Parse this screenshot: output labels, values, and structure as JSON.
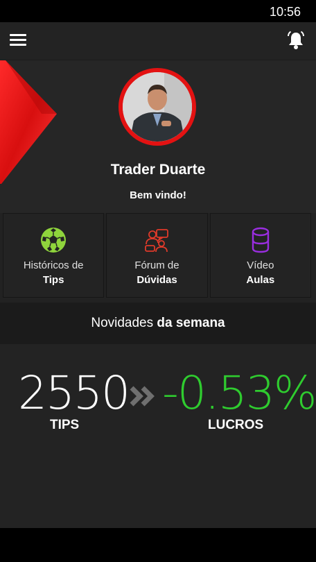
{
  "status_bar": {
    "time": "10:56"
  },
  "top_bar": {
    "menu_icon": "hamburger-menu-icon",
    "bell_icon": "bell-icon"
  },
  "profile": {
    "name": "Trader Duarte",
    "welcome": "Bem vindo!"
  },
  "tiles": [
    {
      "line1": "Históricos de",
      "line2": "Tips",
      "icon": "soccer-ball-icon",
      "color": "#8fd43c"
    },
    {
      "line1": "Fórum de",
      "line2": "Dúvidas",
      "icon": "chat-people-icon",
      "color": "#e03a2a"
    },
    {
      "line1": "Vídeo",
      "line2": "Aulas",
      "icon": "cylinder-icon",
      "color": "#9a2ee0"
    }
  ],
  "news": {
    "title_regular": "Novidades ",
    "title_bold": "da semana"
  },
  "stats": {
    "tips_value": "2550",
    "tips_label": "TIPS",
    "lucros_value": "-0.53%",
    "lucros_label": "LUCROS",
    "lucros_color": "#2fcc2f"
  },
  "colors": {
    "accent_red": "#e31212",
    "background": "#222222"
  }
}
